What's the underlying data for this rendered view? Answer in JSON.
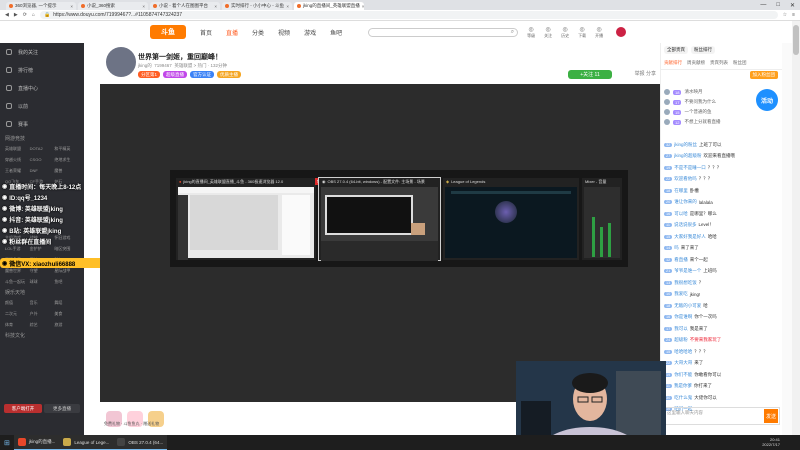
{
  "browser": {
    "tabs": [
      {
        "label": "360浏览器, 一个提示",
        "active": false
      },
      {
        "label": "小说_360搜索",
        "active": false
      },
      {
        "label": "小说 - 着个人在图图平台",
        "active": false
      },
      {
        "label": "实时排行 - 小小中心 - 斗鱼",
        "active": false
      },
      {
        "label": "jking的直播间_英雄联盟直播",
        "active": true
      }
    ],
    "url": "https://www.douyu.com/71999467?...#1105874747324237"
  },
  "site": {
    "logo": "斗鱼",
    "nav": [
      "首页",
      "直播",
      "分类",
      "视频",
      "游戏",
      "鱼吧"
    ],
    "active_nav": "直播",
    "header_icons": [
      "等级",
      "关注",
      "历史",
      "下载",
      "开播"
    ]
  },
  "sidebar": {
    "items": [
      "我的关注",
      "排行榜",
      "直播中心",
      "以前",
      "赛事"
    ],
    "group1_title": "网游竞技",
    "group1_grid": [
      "英雄联盟",
      "DOTA2",
      "和平精英",
      "穿越火线",
      "CSGO",
      "绝地求生",
      "王者荣耀",
      "DNF",
      "魔兽",
      "QQ飞车",
      "CF手游",
      "炉石"
    ],
    "group2_grid": [
      "主机游戏",
      "战神",
      "怀旧游戏",
      "LOL手游",
      "金铲铲",
      "暗区突围",
      "星际争霸",
      "原神",
      "科幻",
      "魔兽世界",
      "守望",
      "星际战甲",
      "斗鱼一起玩",
      "球球",
      "鱼吧"
    ],
    "group3_title": "娱乐天地",
    "group3_grid": [
      "颜值",
      "音乐",
      "舞蹈",
      "二次元",
      "户外",
      "美食",
      "体育",
      "综艺",
      "旅游"
    ],
    "group4_title": "科技文化",
    "overlay_lines": [
      "直播时间：每天晚上8-12点",
      "ID:qq号_1234",
      "微博: 英雄联盟jking",
      "抖音: 英雄联盟jking",
      "B站: 英雄联盟jking",
      "粉丝群在直播间"
    ],
    "wechat_line": "微信VX: xiaozhuli66888",
    "bottom_btn": "客户端打开",
    "bottom_btn2": "更多直播"
  },
  "streamer": {
    "title": "世界第一剑姬，重回巅峰！",
    "name": "jking的",
    "room_id": "7199467",
    "category": "英雄联盟",
    "meta": "英雄联盟 > 热门 · 132分钟",
    "badges": [
      "分区第1",
      "超级直播",
      "官方认证",
      "优质主播"
    ],
    "follow_label": "+关注  11",
    "report": "举报",
    "share": "分享"
  },
  "switcher": {
    "windows": [
      {
        "title": "jking的直播间_英雄联盟直播_斗鱼 - 360极速浏览器 12.0"
      },
      {
        "title": "OBS 27.0.4 (64-bit, windows) - 配置文件: 主场景 - 场景"
      },
      {
        "title": "League of Legends"
      },
      {
        "title": "Mixer - 音量"
      }
    ]
  },
  "chat": {
    "top_buttons": [
      "全部贵宾",
      "粉丝排行"
    ],
    "tabs": [
      "贡献排行",
      "周贡献榜",
      "贵宾列表",
      "粉丝团"
    ],
    "fans_button": "加入粉丝团",
    "ranking": [
      {
        "lv": "18",
        "name": "清水映月"
      },
      {
        "lv": "17",
        "name": "不要问我为什么"
      },
      {
        "lv": "15",
        "name": "一个普通的鱼"
      },
      {
        "lv": "12",
        "name": "不想上分就看直播"
      }
    ],
    "messages": [
      {
        "lv": "32",
        "name": "jking的粉丝",
        "text": "上班了可以",
        "red": false
      },
      {
        "lv": "27",
        "name": "jking的超级粉",
        "text": "欢迎来看直播哦",
        "red": false
      },
      {
        "lv": "19",
        "name": "不是不是睡一口",
        "text": "？？？",
        "red": false
      },
      {
        "lv": "22",
        "name": "欢迎看他吗",
        "text": "？？？",
        "red": false
      },
      {
        "lv": "18",
        "name": "在哪里",
        "text": "卧槽",
        "red": false
      },
      {
        "lv": "20",
        "name": "谁让你来的",
        "text": "lalalala",
        "red": false
      },
      {
        "lv": "16",
        "name": "可以哈",
        "text": "是哪里？哪么",
        "red": false
      },
      {
        "lv": "11",
        "name": "说话说很多",
        "text": "Level！",
        "red": false
      },
      {
        "lv": "15",
        "name": "大家好我是好人",
        "text": "哈哈",
        "red": false
      },
      {
        "lv": "14",
        "name": "吗",
        "text": "来了来了",
        "red": false
      },
      {
        "lv": "12",
        "name": "看直播",
        "text": "来个一起",
        "red": false
      },
      {
        "lv": "21",
        "name": "爷爷是谁一个",
        "text": "上班吗",
        "red": false
      },
      {
        "lv": "13",
        "name": "我很想吃饭",
        "text": "？",
        "red": false
      },
      {
        "lv": "10",
        "name": "我爱吃",
        "text": "jking!",
        "red": false
      },
      {
        "lv": "18",
        "name": "无敌的小可爱",
        "text": "哈",
        "red": false
      },
      {
        "lv": "16",
        "name": "你是谁啊",
        "text": "你个一次吗",
        "red": false
      },
      {
        "lv": "17",
        "name": "我可以",
        "text": "我是来了",
        "red": false
      },
      {
        "lv": "24",
        "name": "超级粉",
        "text": "不要来我家玩了",
        "red": true
      },
      {
        "lv": "15",
        "name": "哈哈哈哈",
        "text": "？？？",
        "red": false
      },
      {
        "lv": "22",
        "name": "大哥大哥",
        "text": "来了",
        "red": false
      },
      {
        "lv": "19",
        "name": "你们不能",
        "text": "你敢看你可以",
        "red": false
      },
      {
        "lv": "11",
        "name": "我是你爹",
        "text": "你打来了",
        "red": false
      },
      {
        "lv": "30",
        "name": "吃什么鬼",
        "text": "大佬你可以",
        "red": false
      },
      {
        "lv": "16",
        "name": "咱们一起",
        "text": "",
        "red": false
      }
    ],
    "input_placeholder": "这里输入聊天内容",
    "send": "发送"
  },
  "gifts_bar": {
    "text": "免费礼物 · 斗鱼鱼丸 · 赠送礼物"
  },
  "taskbar": {
    "items": [
      {
        "label": "jking的直播...",
        "color": "#e8472a",
        "open": true
      },
      {
        "label": "League of Lege...",
        "color": "#c8a94a",
        "open": true
      },
      {
        "label": "OBS 27.0.4 (64...",
        "color": "#444444",
        "open": true
      }
    ],
    "time": "20:41",
    "date": "2022/7/17"
  },
  "window_controls": [
    "—",
    "□",
    "✕"
  ]
}
